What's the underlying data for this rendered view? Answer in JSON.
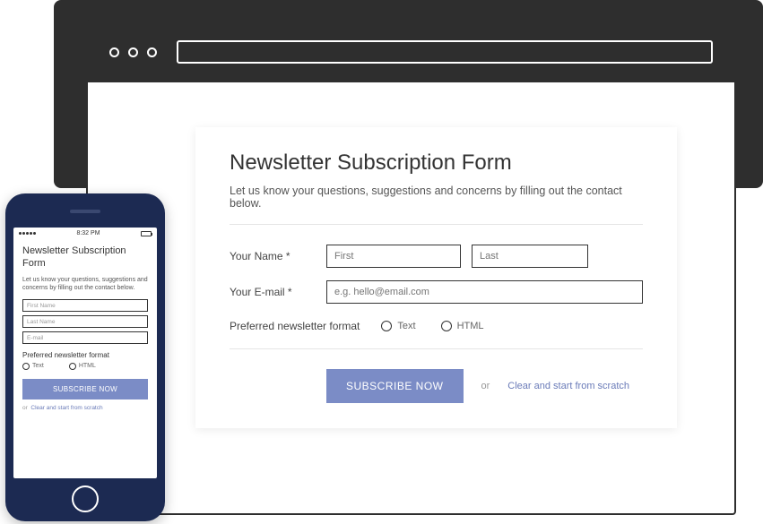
{
  "desktop": {
    "title": "Newsletter Subscription Form",
    "subtitle": "Let us know your questions, suggestions and concerns by filling out the contact below.",
    "name_label": "Your Name *",
    "first_placeholder": "First",
    "last_placeholder": "Last",
    "email_label": "Your E-mail *",
    "email_placeholder": "e.g. hello@email.com",
    "format_label": "Preferred newsletter format",
    "radio_text": "Text",
    "radio_html": "HTML",
    "subscribe_label": "SUBSCRIBE NOW",
    "or_label": "or",
    "clear_label": "Clear and start from scratch"
  },
  "phone": {
    "time": "8:32 PM",
    "title": "Newsletter Subscription Form",
    "subtitle": "Let us know your questions, suggestions and concerns by filling out the contact below.",
    "first_placeholder": "First Name",
    "last_placeholder": "Last Name",
    "email_placeholder": "E-mail",
    "format_label": "Preferred newsletter format",
    "radio_text": "Text",
    "radio_html": "HTML",
    "subscribe_label": "SUBSCRIBE NOW",
    "or_label": "or",
    "clear_label": "Clear and start from scratch"
  }
}
